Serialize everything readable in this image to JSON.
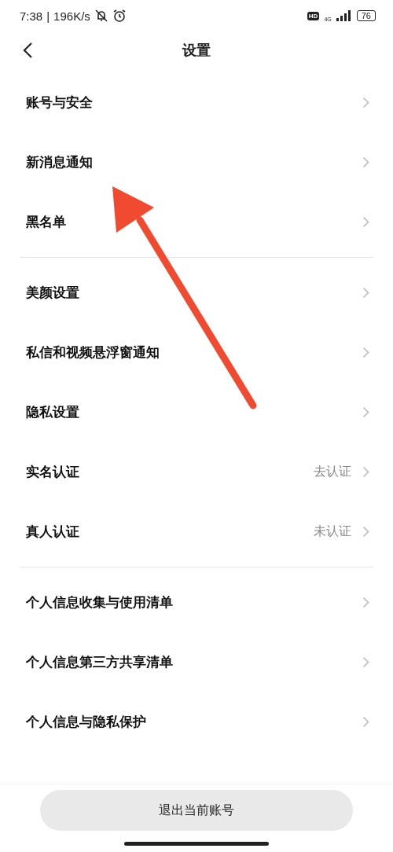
{
  "status_bar": {
    "time": "7:38",
    "separator": "|",
    "speed": "196K/s",
    "hd": "HD",
    "network": "4G",
    "battery": "76"
  },
  "header": {
    "title": "设置"
  },
  "groups": [
    {
      "items": [
        {
          "label": "账号与安全"
        },
        {
          "label": "新消息通知"
        },
        {
          "label": "黑名单"
        }
      ]
    },
    {
      "items": [
        {
          "label": "美颜设置"
        },
        {
          "label": "私信和视频悬浮窗通知"
        },
        {
          "label": "隐私设置"
        },
        {
          "label": "实名认证",
          "value": "去认证"
        },
        {
          "label": "真人认证",
          "value": "未认证"
        }
      ]
    },
    {
      "items": [
        {
          "label": "个人信息收集与使用清单"
        },
        {
          "label": "个人信息第三方共享清单"
        },
        {
          "label": "个人信息与隐私保护"
        }
      ]
    }
  ],
  "logout_button": "退出当前账号"
}
